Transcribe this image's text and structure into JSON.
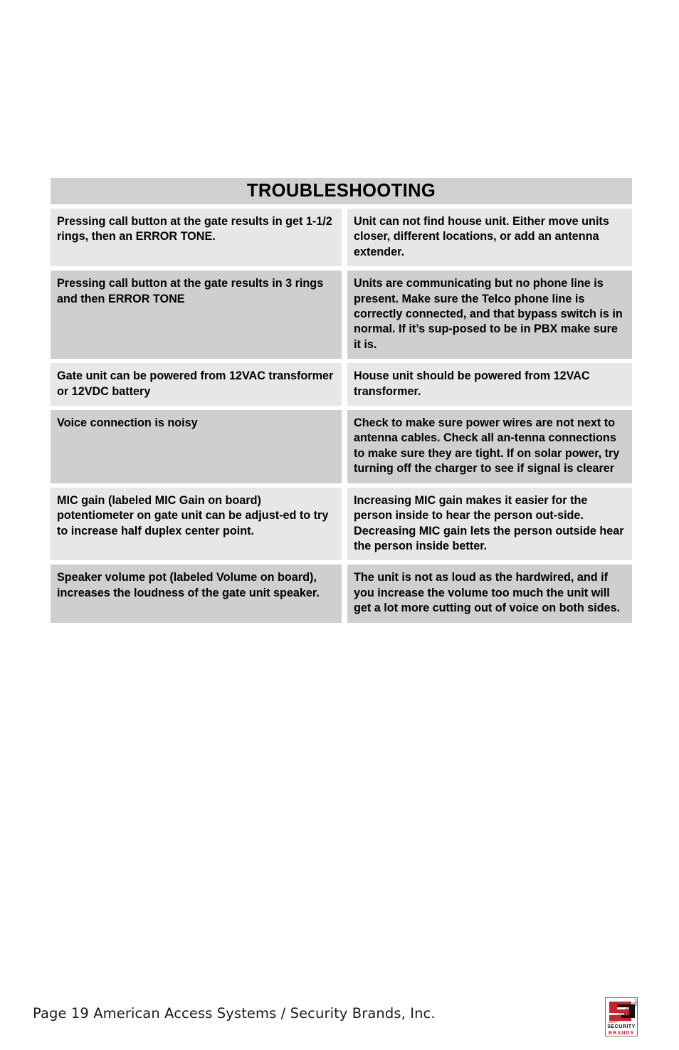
{
  "document": {
    "table": {
      "title": "TROUBLESHOOTING",
      "rows": [
        {
          "symptom": "Pressing call button at the gate results in get 1-1/2 rings, then an ERROR TONE.",
          "solution": "Unit can not find house unit. Either move units closer, different locations, or add an antenna extender.",
          "shade": "light"
        },
        {
          "symptom": "Pressing call button at the gate results in 3 rings and then ERROR TONE",
          "solution": "Units are communicating but no phone line is present.  Make sure the Telco phone line is correctly connected, and that bypass switch is in normal. If it’s sup-posed to be in PBX make sure it is.",
          "shade": "dark"
        },
        {
          "symptom": "Gate unit can be powered from 12VAC transformer or 12VDC battery",
          "solution": "House unit should be powered from 12VAC transformer.",
          "shade": "light"
        },
        {
          "symptom": "Voice connection is noisy",
          "solution": "Check to make sure power wires are not next to antenna cables.  Check all an-tenna connections to make sure they are tight. If on solar power, try turning off the charger to see if signal is clearer",
          "shade": "dark"
        },
        {
          "symptom": "MIC gain (labeled MIC Gain on board) potentiometer on gate unit can be adjust-ed to try to increase half duplex center point.",
          "solution": "Increasing MIC gain makes it easier for the person inside to hear the person out-side.  Decreasing MIC gain lets the person outside hear the person inside better.",
          "shade": "light"
        },
        {
          "symptom": "Speaker volume pot (labeled Volume on board), increases the loudness of the gate unit speaker.",
          "solution": "The unit is not as loud as the hardwired, and if you increase the volume too much the unit will get a lot more cutting out of voice on both sides.",
          "shade": "dark"
        }
      ]
    },
    "footer": {
      "page_line": "Page 19 American Access Systems / Security Brands, Inc.",
      "logo": {
        "word_top": "SECURITY",
        "word_bottom": "BRANDS",
        "trademark": "™",
        "red": "#cc2229",
        "black": "#111111",
        "gray": "#bdbdbd"
      }
    },
    "colors": {
      "header_bg": "#d0d0d0",
      "row_light": "#e7e7e7",
      "row_dark": "#cfcfcf",
      "page_bg": "#ffffff",
      "text": "#000000"
    }
  }
}
